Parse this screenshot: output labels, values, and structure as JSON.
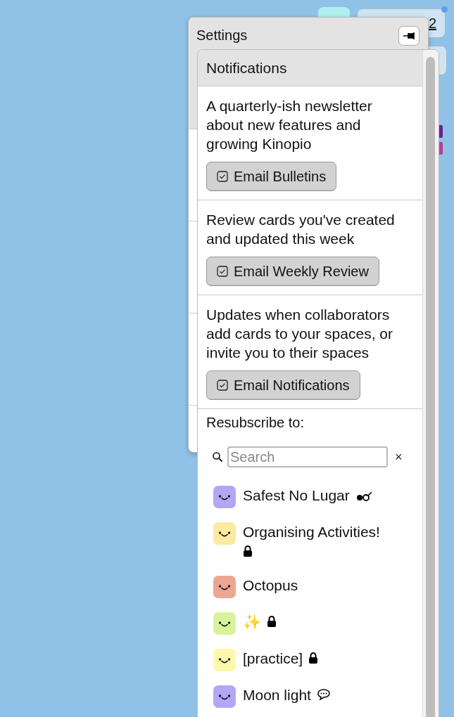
{
  "canvas": {
    "count": "2"
  },
  "settings": {
    "title": "Settings"
  },
  "notifications": {
    "title": "Notifications",
    "sections": [
      {
        "description": "A quarterly-ish newsletter about new features and growing Kinopio",
        "button": {
          "label": "Email Bulletins",
          "checked": true
        }
      },
      {
        "description": "Review cards you've created and updated this week",
        "button": {
          "label": "Email Weekly Review",
          "checked": true
        }
      },
      {
        "description": "Updates when collaborators add cards to your spaces, or invite you to their spaces",
        "button": {
          "label": "Email Notifications",
          "checked": true
        }
      }
    ],
    "resubscribe_label": "Resubscribe to:",
    "search": {
      "placeholder": "Search",
      "clear": "×"
    },
    "spaces": [
      {
        "name": "Safest No Lugar",
        "color": "#b3a6f4",
        "locked": false,
        "glasses": true,
        "comments": false
      },
      {
        "name": "Organising Activities!",
        "color": "#fbeaa0",
        "locked": true,
        "glasses": false,
        "comments": false
      },
      {
        "name": "Octopus",
        "color": "#eba792",
        "locked": false,
        "glasses": false,
        "comments": false
      },
      {
        "name": "✨",
        "color": "#d9f39d",
        "locked": true,
        "glasses": false,
        "comments": false
      },
      {
        "name": "[practice]",
        "color": "#fcf9ab",
        "locked": true,
        "glasses": false,
        "comments": false
      },
      {
        "name": "Moon light",
        "color": "#b3a6f4",
        "locked": false,
        "glasses": false,
        "comments": true
      }
    ]
  }
}
